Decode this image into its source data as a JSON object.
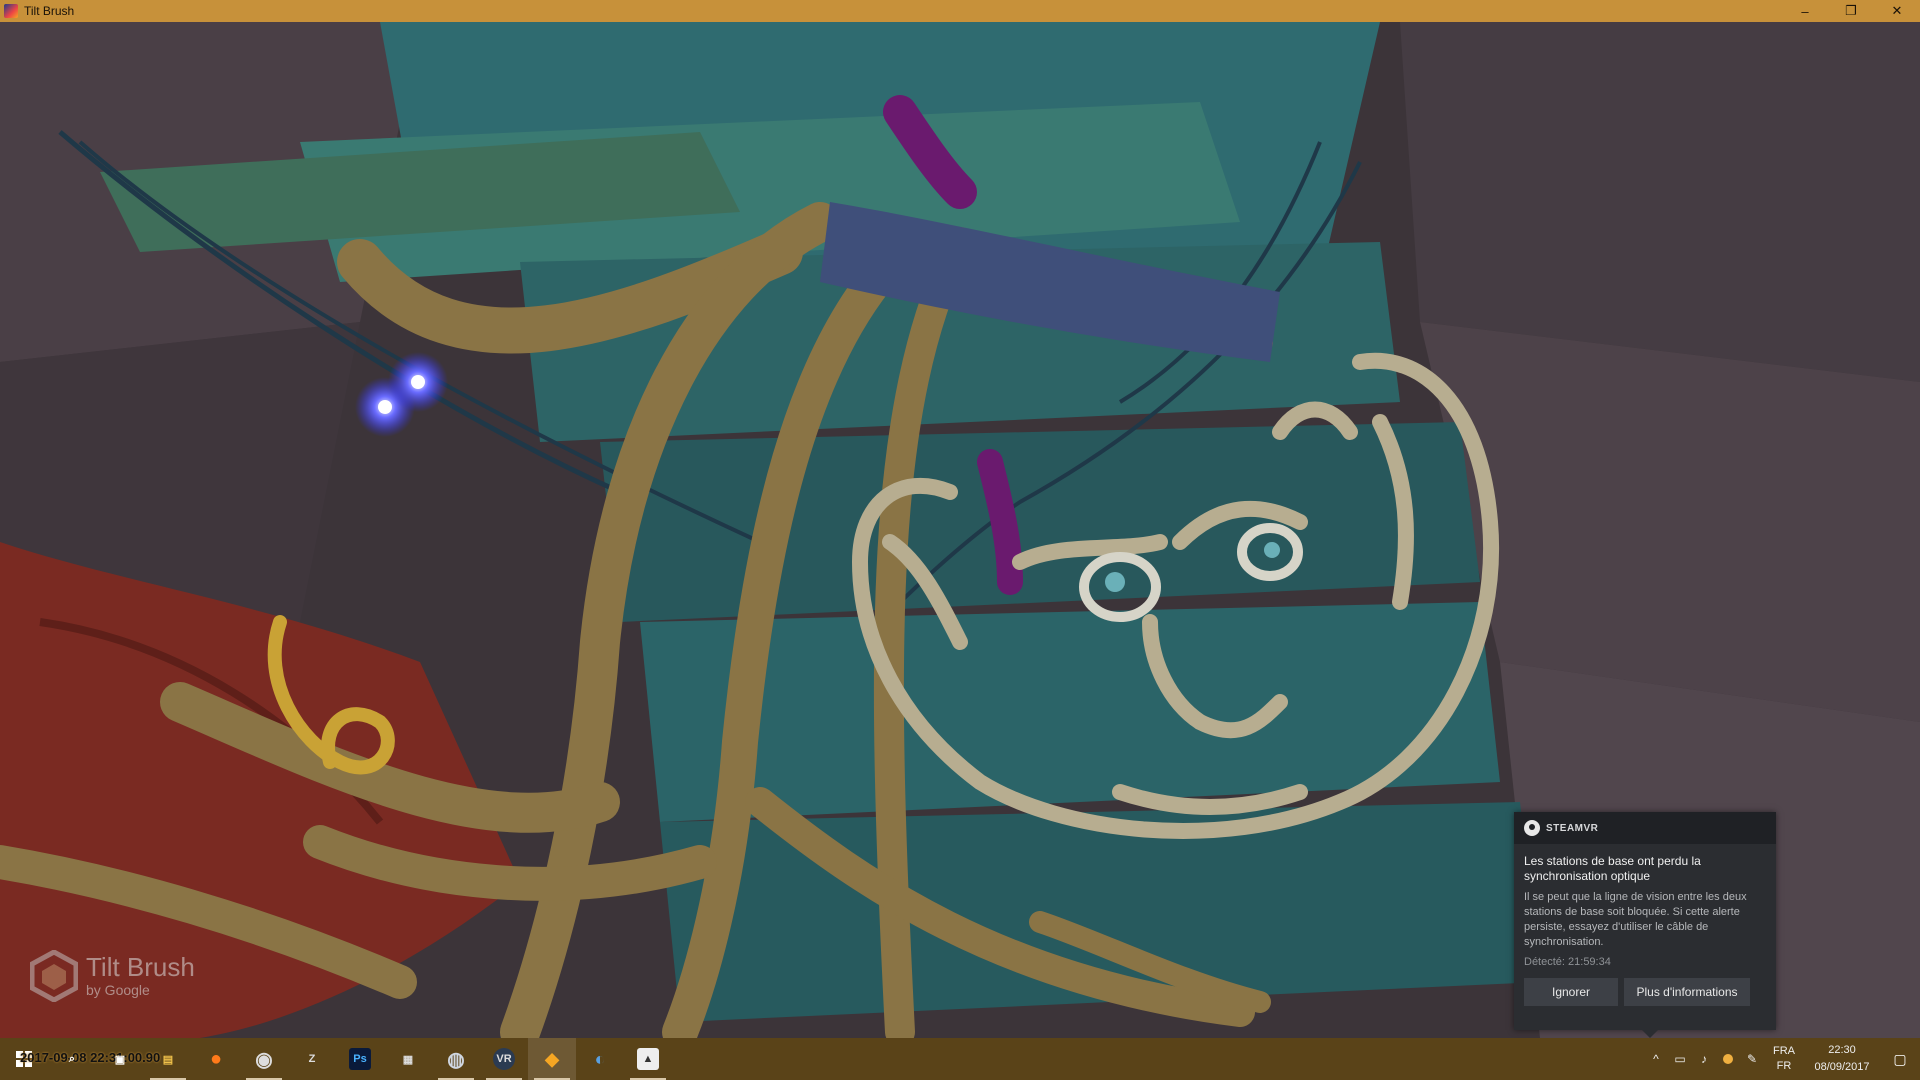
{
  "window": {
    "title": "Tilt Brush",
    "minimize_glyph": "–",
    "restore_glyph": "❐",
    "close_glyph": "✕"
  },
  "watermark": {
    "name": "Tilt Brush",
    "by": "by Google"
  },
  "notification": {
    "brand": "STEAMVR",
    "title": "Les stations de base ont perdu la synchronisation optique",
    "body": "Il se peut que la ligne de vision entre les deux stations de base soit bloquée. Si cette alerte persiste, essayez d'utiliser le câble de synchronisation.",
    "detected": "Détecté: 21:59:34",
    "ignore_label": "Ignorer",
    "more_label": "Plus d'informations"
  },
  "taskbar": {
    "stamp": "2017-09-08 22:31:00.90",
    "apps": [
      {
        "id": "search",
        "glyph": "⌕"
      },
      {
        "id": "task-view",
        "glyph": "▣"
      },
      {
        "id": "file-explorer",
        "glyph": "▤"
      },
      {
        "id": "firefox",
        "glyph": "●"
      },
      {
        "id": "obs",
        "glyph": "◉"
      },
      {
        "id": "zbrush",
        "glyph": "Z"
      },
      {
        "id": "photoshop",
        "glyph": "Ps"
      },
      {
        "id": "video-editor",
        "glyph": "▦"
      },
      {
        "id": "steam",
        "glyph": "◍"
      },
      {
        "id": "steamvr",
        "glyph": "VR"
      },
      {
        "id": "tilt-brush",
        "glyph": "◆"
      },
      {
        "id": "blender",
        "glyph": "◐"
      },
      {
        "id": "photos",
        "glyph": "▲"
      }
    ],
    "tray": {
      "chevron": "^",
      "lang_top": "FRA",
      "lang_bottom": "FR",
      "time": "22:30",
      "date": "08/09/2017"
    }
  },
  "colors": {
    "titlebar": "#c7913a",
    "taskbar": "#5a4318",
    "notification_bg": "#2b2d31"
  }
}
